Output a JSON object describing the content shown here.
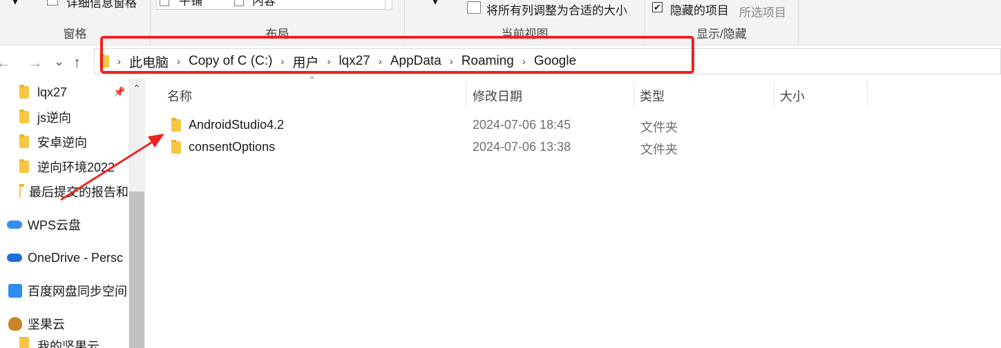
{
  "ribbon": {
    "pane_group": {
      "detail_pane": "详细信息窗格",
      "label": "窗格"
    },
    "layout_group": {
      "tile": "平铺",
      "content": "内容",
      "label": "布局"
    },
    "view_group": {
      "fit_columns": "将所有列调整为合适的大小",
      "label": "当前视图"
    },
    "show_hide_group": {
      "hidden_items": "隐藏的项目",
      "hidden_checked": "✔",
      "hide_selected": "所选项目",
      "label": "显示/隐藏"
    }
  },
  "nav": {
    "back": "←",
    "forward": "→",
    "recent": "⌄",
    "up": "↑"
  },
  "breadcrumb": [
    "此电脑",
    "Copy of C (C:)",
    "用户",
    "lqx27",
    "AppData",
    "Roaming",
    "Google"
  ],
  "sidebar": {
    "items": [
      {
        "label": "lqx27"
      },
      {
        "label": "js逆向"
      },
      {
        "label": "安卓逆向"
      },
      {
        "label": "逆向环境2022"
      },
      {
        "label": "最后提交的报告和"
      },
      {
        "label": "WPS云盘"
      },
      {
        "label": "OneDrive - Persc"
      },
      {
        "label": "百度网盘同步空间"
      },
      {
        "label": "坚果云"
      },
      {
        "label": "我的坚果云"
      }
    ]
  },
  "columns": {
    "name": "名称",
    "modified": "修改日期",
    "type": "类型",
    "size": "大小"
  },
  "files": [
    {
      "name": "AndroidStudio4.2",
      "modified": "2024-07-06 18:45",
      "type": "文件夹"
    },
    {
      "name": "consentOptions",
      "modified": "2024-07-06 13:38",
      "type": "文件夹"
    }
  ],
  "colors": {
    "annotation": "#ee2222",
    "folder": "#f6c744"
  }
}
